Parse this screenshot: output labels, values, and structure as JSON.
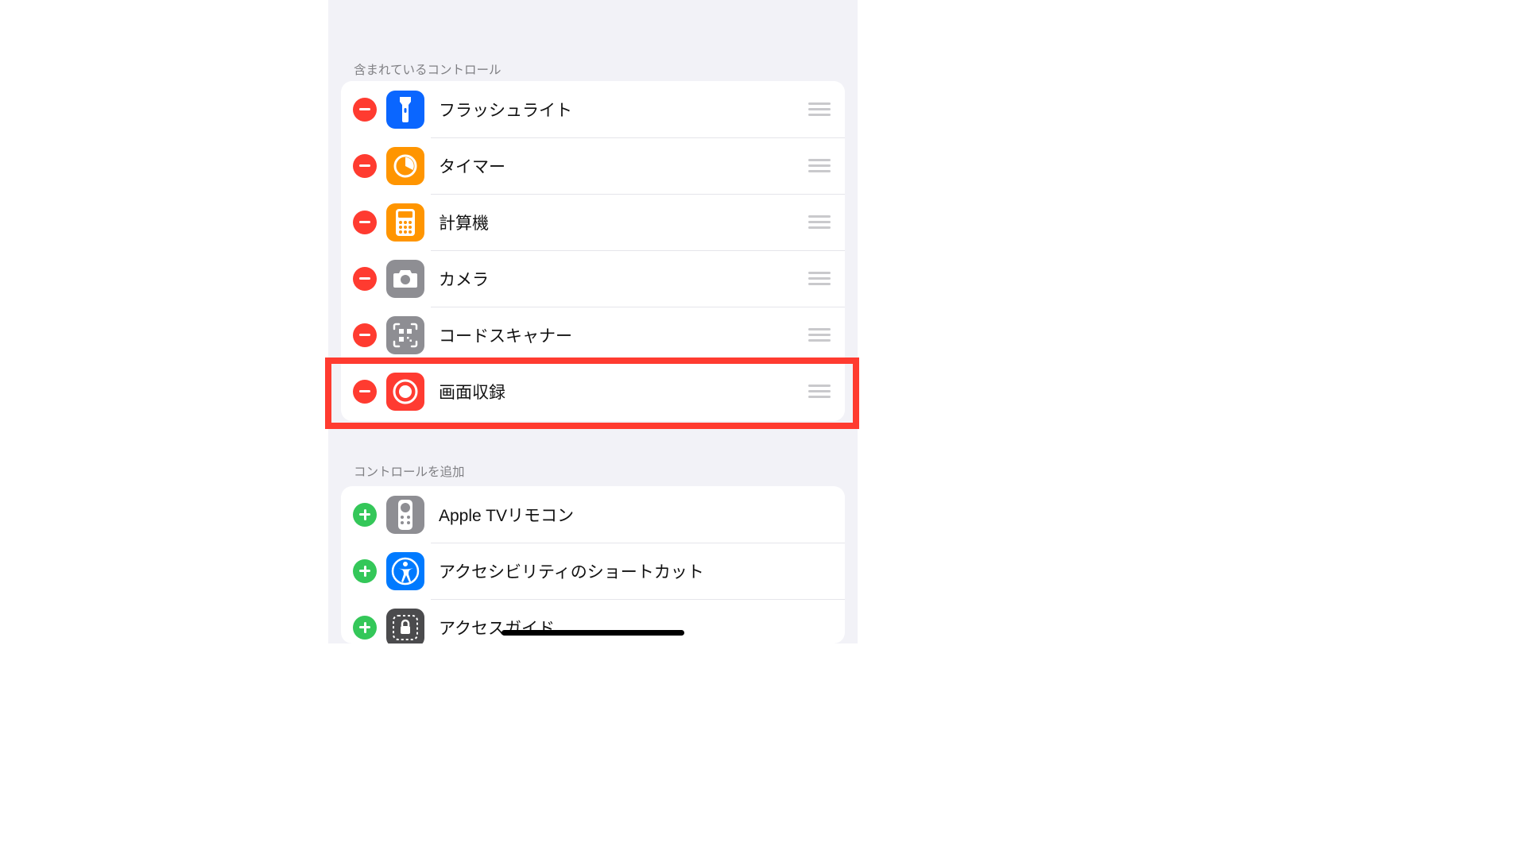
{
  "sections": {
    "included_header": "含まれているコントロール",
    "more_header": "コントロールを追加"
  },
  "included": [
    {
      "label": "フラッシュライト",
      "icon": "flashlight-icon"
    },
    {
      "label": "タイマー",
      "icon": "timer-icon"
    },
    {
      "label": "計算機",
      "icon": "calculator-icon"
    },
    {
      "label": "カメラ",
      "icon": "camera-icon"
    },
    {
      "label": "コードスキャナー",
      "icon": "code-scanner-icon"
    },
    {
      "label": "画面収録",
      "icon": "screen-recording-icon"
    }
  ],
  "more": [
    {
      "label": "Apple TVリモコン",
      "icon": "apple-tv-remote-icon"
    },
    {
      "label": "アクセシビリティのショートカット",
      "icon": "accessibility-icon"
    },
    {
      "label": "アクセスガイド",
      "icon": "guided-access-icon"
    }
  ],
  "colors": {
    "remove_red": "#FF3B30",
    "add_green": "#34C759"
  },
  "highlighted_index": 5
}
